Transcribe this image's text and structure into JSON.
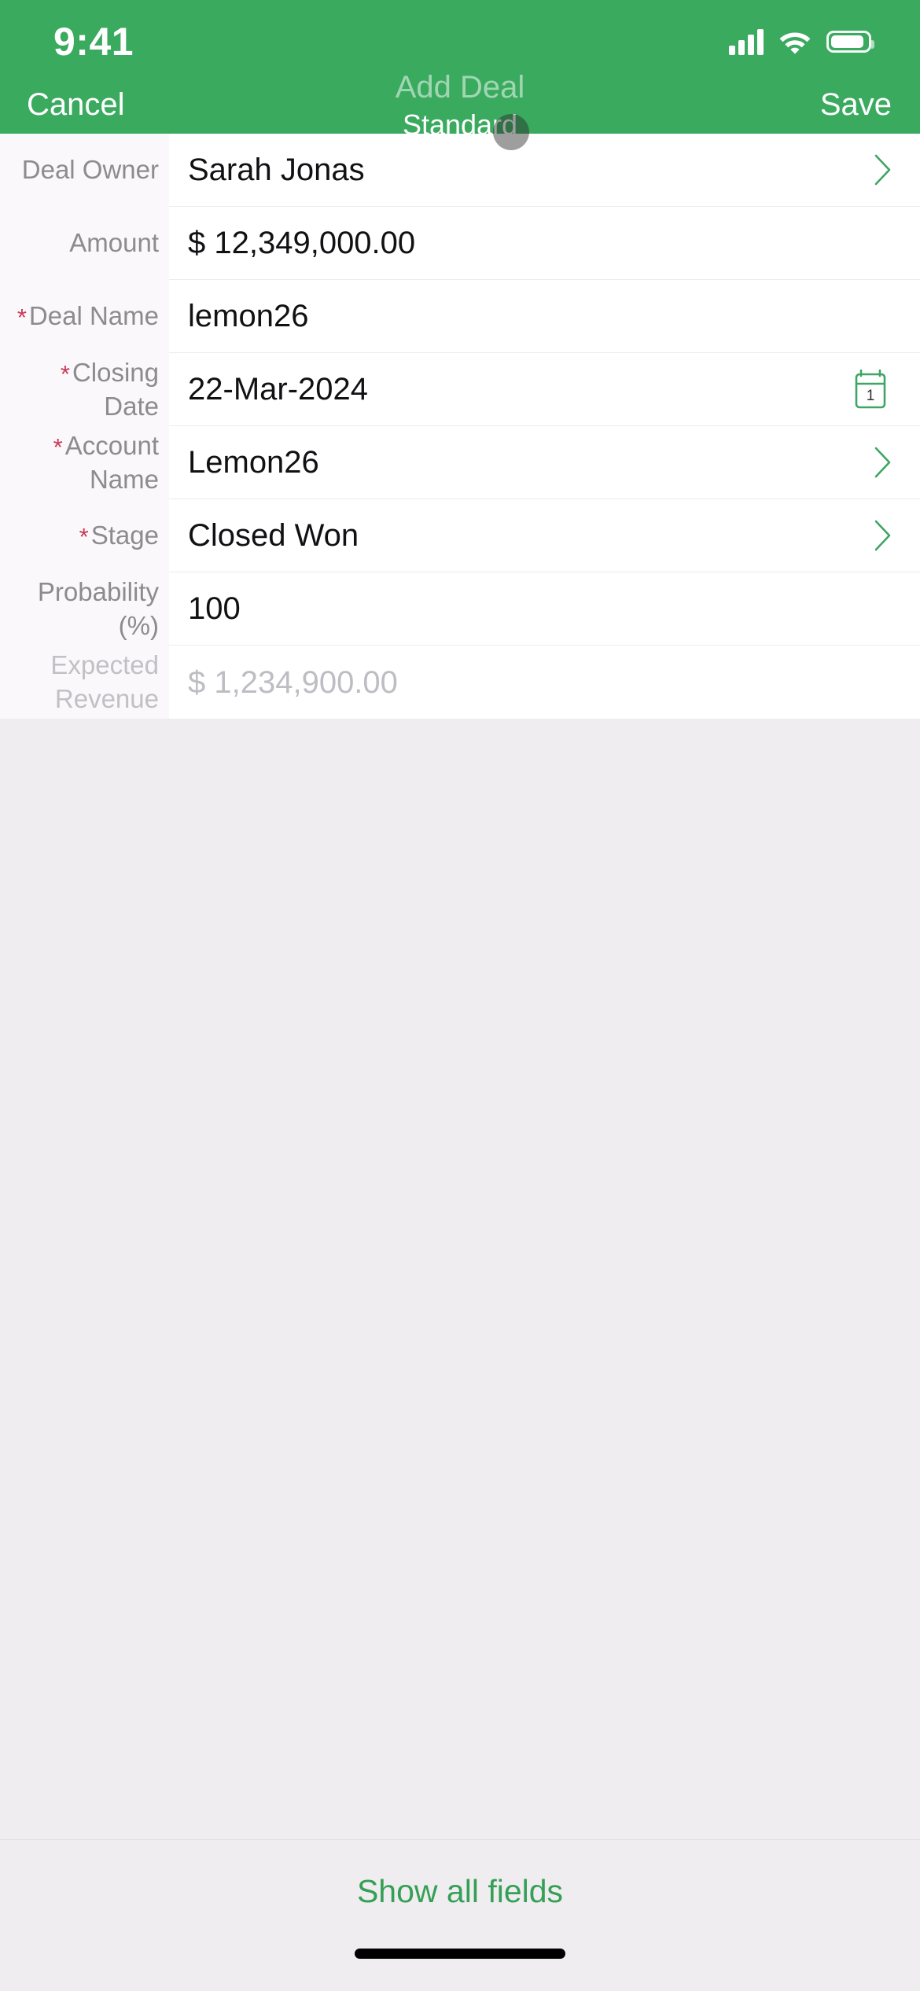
{
  "status_bar": {
    "time": "9:41",
    "signal_icon": "cellular-signal-icon",
    "wifi_icon": "wifi-icon",
    "battery_icon": "battery-icon"
  },
  "nav": {
    "cancel_label": "Cancel",
    "title": "Add Deal",
    "subtitle": "Standard",
    "save_label": "Save",
    "accent_color": "#3aaa5f"
  },
  "form": {
    "fields": [
      {
        "label": "Deal Owner",
        "required": false,
        "value": "Sarah Jonas",
        "accessory": "chevron",
        "disabled": false
      },
      {
        "label": "Amount",
        "required": false,
        "value": "$ 12,349,000.00",
        "accessory": "none",
        "disabled": false
      },
      {
        "label": "Deal Name",
        "required": true,
        "value": "lemon26",
        "accessory": "none",
        "disabled": false
      },
      {
        "label": "Closing Date",
        "required": true,
        "value": "22-Mar-2024",
        "accessory": "calendar",
        "disabled": false
      },
      {
        "label": "Account Name",
        "required": true,
        "value": "Lemon26",
        "accessory": "chevron",
        "disabled": false
      },
      {
        "label": "Stage",
        "required": true,
        "value": "Closed Won",
        "accessory": "chevron",
        "disabled": false
      },
      {
        "label": "Probability (%)",
        "required": false,
        "value": "100",
        "accessory": "none",
        "disabled": false
      },
      {
        "label": "Expected Revenue",
        "required": false,
        "value": "$ 1,234,900.00",
        "accessory": "none",
        "disabled": true
      }
    ],
    "required_marker": "*",
    "required_marker_color": "#c93a56",
    "calendar_icon_day": "1"
  },
  "footer": {
    "show_all_label": "Show all fields",
    "link_color": "#35a055"
  }
}
